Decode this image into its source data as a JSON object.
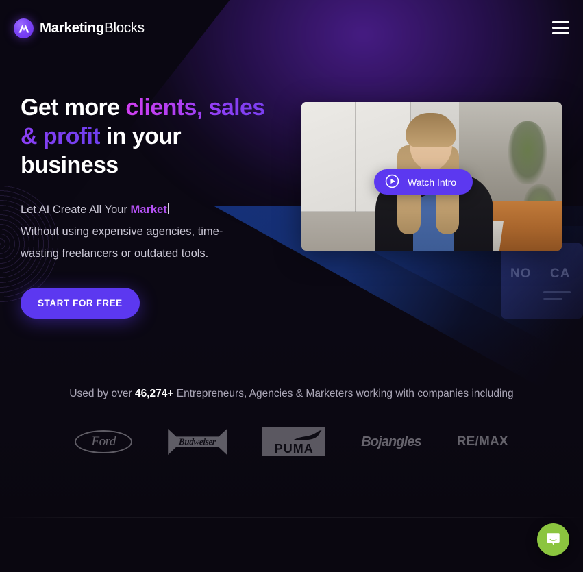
{
  "header": {
    "logo": {
      "icon": "marketingblocks-logo-icon",
      "bold_part": "Marketing",
      "light_part": "Blocks"
    },
    "menu_icon": "hamburger-menu-icon"
  },
  "hero": {
    "headline": {
      "line1_white": "Get more ",
      "line1_gradient": "clients, sales",
      "line2_gradient": "& profit",
      "line2_white": " in your",
      "line3_white": "business"
    },
    "subhead": {
      "static_prefix": "Let AI Create All Your ",
      "typed_word": "Market",
      "line2": "Without using expensive agencies, time-",
      "line3": "wasting freelancers or outdated tools."
    },
    "cta_label": "START FOR FREE",
    "video": {
      "watch_label": "Watch Intro",
      "play_icon": "play-circle-icon"
    }
  },
  "social_proof": {
    "prefix": "Used by over ",
    "count": "46,274+",
    "suffix": " Entrepreneurs, Agencies & Marketers working with companies including",
    "brands": [
      {
        "name": "Ford",
        "label": "Ford"
      },
      {
        "name": "Budweiser",
        "label": "Budweiser"
      },
      {
        "name": "Puma",
        "label": "PUMA"
      },
      {
        "name": "Bojangles",
        "label": "Bojangles"
      },
      {
        "name": "RE/MAX",
        "label": "RE/MAX"
      }
    ]
  },
  "background": {
    "ghost_card_text_1": "NO",
    "ghost_card_text_2": "CA"
  },
  "chat": {
    "icon": "chat-bubble-icon",
    "color": "#8bc53f"
  },
  "colors": {
    "page_bg": "#0b0813",
    "accent_purple": "#5c38f0",
    "gradient_pink": "#d23ff0",
    "gradient_violet": "#7a3ff0",
    "typed_word": "#b552f5",
    "chat_green": "#8bc53f"
  }
}
